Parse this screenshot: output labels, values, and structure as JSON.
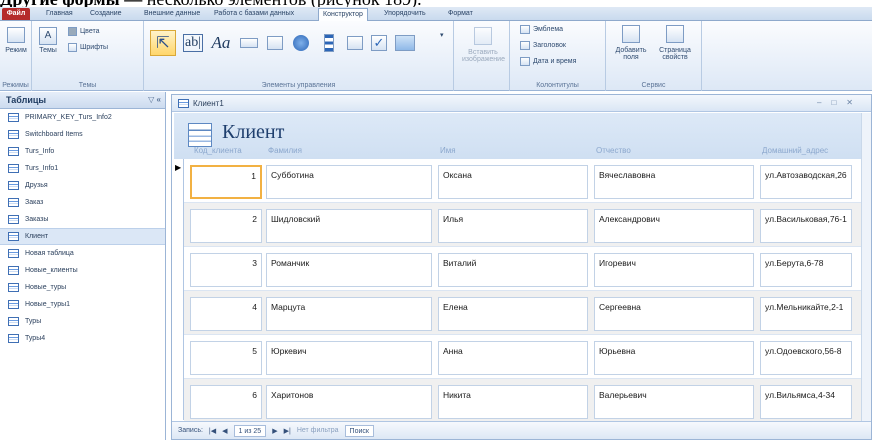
{
  "caption": {
    "bold": "Другие формы —",
    "rest": " несколько элементов (рисунок 189)."
  },
  "tabs": [
    "Файл",
    "Главная",
    "Создание",
    "Внешние данные",
    "Работа с базами данных",
    "Конструктор",
    "Упорядочить",
    "Формат"
  ],
  "ribbon": {
    "views_button": "Режим",
    "views_group": "Режимы",
    "themes_button": "Темы",
    "colors": "Цвета",
    "fonts": "Шрифты",
    "themes_group": "Темы",
    "controls_group": "Элементы управления",
    "insert_image": "Вставить изображение",
    "logo": "Эмблема",
    "title": "Заголовок",
    "date_time": "Дата и время",
    "header_footer_group": "Колонтитулы",
    "add_fields": "Добавить поля",
    "property_sheet": "Страница свойств",
    "tools_group": "Сервис"
  },
  "nav": {
    "header": "Таблицы",
    "items": [
      "PRIMARY_KEY_Turs_Info2",
      "Switchboard Items",
      "Turs_Info",
      "Turs_Info1",
      "Друзья",
      "Заказ",
      "Заказы",
      "Клиент",
      "Новая таблица",
      "Новые_клиенты",
      "Новые_туры",
      "Новые_туры1",
      "Туры",
      "Туры4"
    ],
    "selected_index": 7
  },
  "form": {
    "tab_title": "Клиент1",
    "title": "Клиент",
    "columns": [
      "Код_клиента",
      "Фамилия",
      "Имя",
      "Отчество",
      "Домашний_адрес"
    ],
    "rows": [
      [
        "1",
        "Субботина",
        "Оксана",
        "Вячеславовна",
        "ул.Автозаводская,26"
      ],
      [
        "2",
        "Шидловский",
        "Илья",
        "Александрович",
        "ул.Васильковая,76-1"
      ],
      [
        "3",
        "Романчик",
        "Виталий",
        "Игоревич",
        "ул.Берута,6-78"
      ],
      [
        "4",
        "Марцута",
        "Елена",
        "Сергеевна",
        "ул.Мельникайте,2-1"
      ],
      [
        "5",
        "Юркевич",
        "Анна",
        "Юрьевна",
        "ул.Одоевского,56-8"
      ],
      [
        "6",
        "Харитонов",
        "Никита",
        "Валерьевич",
        "ул.Вильямса,4-34"
      ]
    ]
  },
  "status": {
    "records_label": "Запись:",
    "position": "1 из 25",
    "filter": "Нет фильтра",
    "search": "Поиск"
  }
}
